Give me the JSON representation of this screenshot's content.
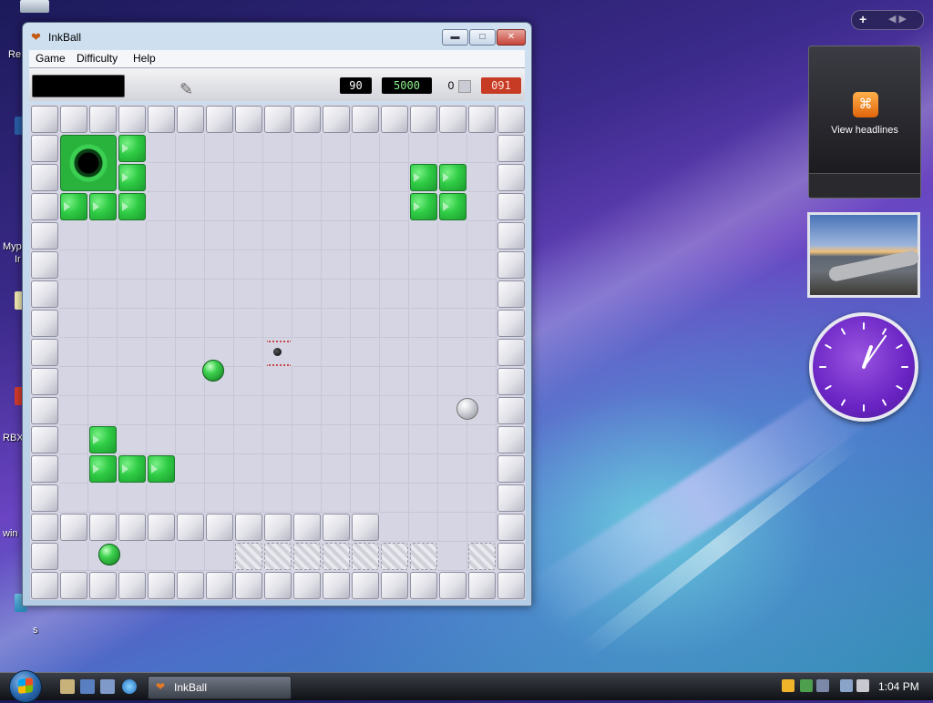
{
  "desktop": {
    "icon_labels": [
      "Re",
      "Myp",
      "Ir",
      "RBX",
      "win",
      "s"
    ]
  },
  "window": {
    "title": "InkBall",
    "icon": "inkball-icon",
    "controls": {
      "minimize": "minimize-icon",
      "maximize": "maximize-icon",
      "close": "close-icon"
    }
  },
  "menu": {
    "game": "Game",
    "difficulty": "Difficulty",
    "help": "Help"
  },
  "status": {
    "time": "90",
    "score": "5000",
    "balls": "0",
    "best": "091",
    "colors": {
      "score_text": "#8cf08c",
      "best_bg": "#c73a24"
    }
  },
  "gadgets": {
    "feed_label": "View headlines",
    "feed_icon": "rss-icon",
    "photo_icon": "landscape-photo",
    "clock_icon": "analog-clock-icon"
  },
  "taskbar": {
    "task_label": "InkBall",
    "time": "1:04 PM"
  }
}
